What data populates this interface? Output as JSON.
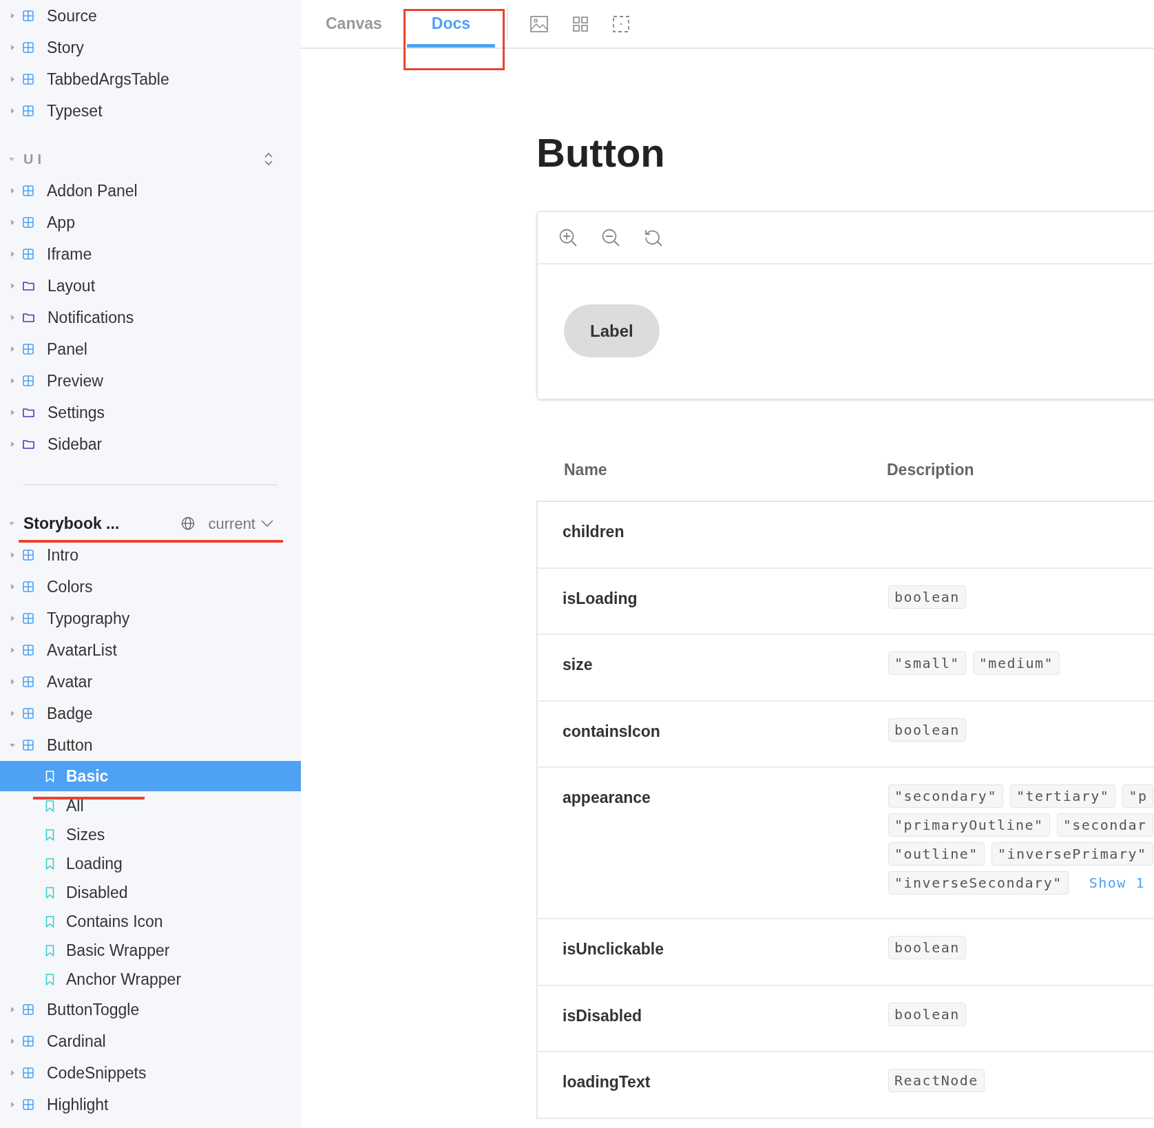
{
  "sidebar": {
    "sections": [
      {
        "items": [
          {
            "label": "Source",
            "kind": "component",
            "expanded": false,
            "selected": false
          },
          {
            "label": "Story",
            "kind": "component",
            "expanded": false,
            "selected": false
          },
          {
            "label": "TabbedArgsTable",
            "kind": "component",
            "expanded": false,
            "selected": false
          },
          {
            "label": "Typeset",
            "kind": "component",
            "expanded": false,
            "selected": false
          }
        ]
      },
      {
        "title": "UI",
        "expanded": true,
        "items": [
          {
            "label": "Addon Panel",
            "kind": "component",
            "expanded": false,
            "selected": false
          },
          {
            "label": "App",
            "kind": "component",
            "expanded": false,
            "selected": false
          },
          {
            "label": "Iframe",
            "kind": "component",
            "expanded": false,
            "selected": false
          },
          {
            "label": "Layout",
            "kind": "folder",
            "expanded": false,
            "selected": false
          },
          {
            "label": "Notifications",
            "kind": "folder",
            "expanded": false,
            "selected": false
          },
          {
            "label": "Panel",
            "kind": "component",
            "expanded": false,
            "selected": false
          },
          {
            "label": "Preview",
            "kind": "component",
            "expanded": false,
            "selected": false
          },
          {
            "label": "Settings",
            "kind": "folder",
            "expanded": false,
            "selected": false
          },
          {
            "label": "Sidebar",
            "kind": "folder",
            "expanded": false,
            "selected": false
          }
        ]
      },
      {
        "title": "Storybook ...",
        "expanded": true,
        "version": "current",
        "items": [
          {
            "label": "Intro",
            "kind": "component",
            "expanded": false,
            "selected": false
          },
          {
            "label": "Colors",
            "kind": "component",
            "expanded": false,
            "selected": false
          },
          {
            "label": "Typography",
            "kind": "component",
            "expanded": false,
            "selected": false
          },
          {
            "label": "AvatarList",
            "kind": "component",
            "expanded": false,
            "selected": false
          },
          {
            "label": "Avatar",
            "kind": "component",
            "expanded": false,
            "selected": false
          },
          {
            "label": "Badge",
            "kind": "component",
            "expanded": false,
            "selected": false
          },
          {
            "label": "Button",
            "kind": "component",
            "expanded": true,
            "selected": false,
            "children": [
              {
                "label": "Basic",
                "kind": "story",
                "selected": true
              },
              {
                "label": "All",
                "kind": "story",
                "selected": false
              },
              {
                "label": "Sizes",
                "kind": "story",
                "selected": false
              },
              {
                "label": "Loading",
                "kind": "story",
                "selected": false
              },
              {
                "label": "Disabled",
                "kind": "story",
                "selected": false
              },
              {
                "label": "Contains Icon",
                "kind": "story",
                "selected": false
              },
              {
                "label": "Basic Wrapper",
                "kind": "story",
                "selected": false
              },
              {
                "label": "Anchor Wrapper",
                "kind": "story",
                "selected": false
              }
            ]
          },
          {
            "label": "ButtonToggle",
            "kind": "component",
            "expanded": false,
            "selected": false
          },
          {
            "label": "Cardinal",
            "kind": "component",
            "expanded": false,
            "selected": false
          },
          {
            "label": "CodeSnippets",
            "kind": "component",
            "expanded": false,
            "selected": false
          },
          {
            "label": "Highlight",
            "kind": "component",
            "expanded": false,
            "selected": false
          }
        ]
      }
    ]
  },
  "tabs": [
    {
      "label": "Canvas",
      "selected": false
    },
    {
      "label": "Docs",
      "selected": true
    }
  ],
  "docs": {
    "title": "Button",
    "preview": {
      "button_label": "Label"
    },
    "table": {
      "columns": [
        "Name",
        "Description"
      ],
      "rows": [
        {
          "name": "children",
          "value_lines": []
        },
        {
          "name": "isLoading",
          "value_lines": [
            [
              "boolean"
            ]
          ]
        },
        {
          "name": "size",
          "value_lines": [
            [
              "\"small\"",
              "\"medium\""
            ]
          ]
        },
        {
          "name": "containsIcon",
          "value_lines": [
            [
              "boolean"
            ]
          ]
        },
        {
          "name": "appearance",
          "value_lines": [
            [
              "\"secondary\"",
              "\"tertiary\"",
              "\"p"
            ],
            [
              "\"primaryOutline\"",
              "\"secondar"
            ],
            [
              "\"outline\"",
              "\"inversePrimary\""
            ],
            [
              "\"inverseSecondary\""
            ]
          ],
          "show_more": "Show 1"
        },
        {
          "name": "isUnclickable",
          "value_lines": [
            [
              "boolean"
            ]
          ]
        },
        {
          "name": "isDisabled",
          "value_lines": [
            [
              "boolean"
            ]
          ]
        },
        {
          "name": "loadingText",
          "value_lines": [
            [
              "ReactNode"
            ]
          ]
        }
      ]
    }
  }
}
